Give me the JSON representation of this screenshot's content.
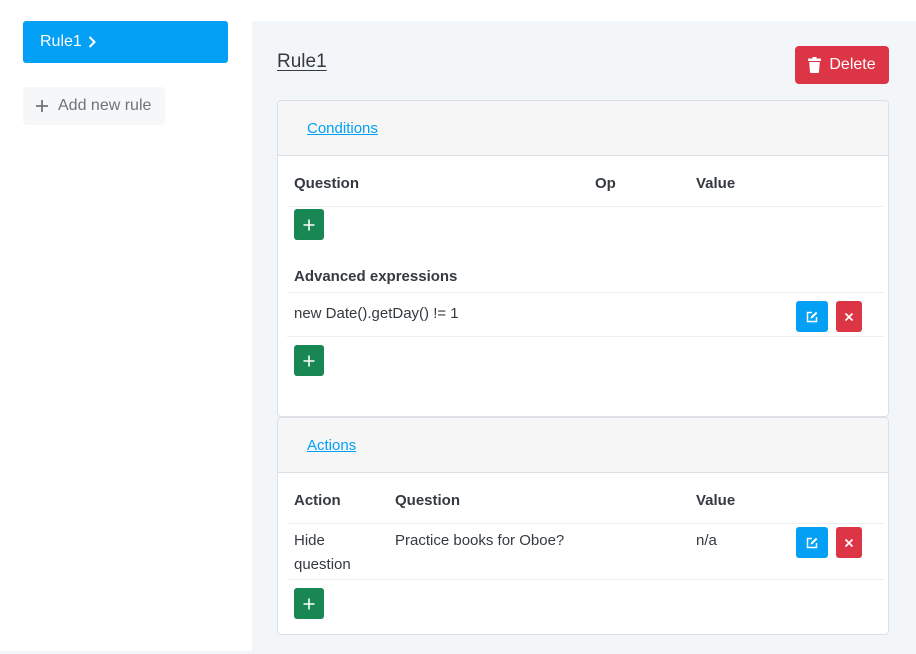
{
  "sidebar": {
    "active_rule": "Rule1",
    "add_rule_label": "Add new rule"
  },
  "main": {
    "rule_title": "Rule1",
    "delete_label": "Delete",
    "conditions": {
      "header_link": "Conditions",
      "columns": [
        "Question",
        "Op",
        "Value"
      ],
      "rows": [],
      "advanced_title": "Advanced expressions",
      "advanced_expressions": [
        "new Date().getDay() != 1"
      ]
    },
    "actions": {
      "header_link": "Actions",
      "columns": [
        "Action",
        "Question",
        "Value"
      ],
      "rows": [
        {
          "action": "Hide question",
          "question": "Practice books for Oboe?",
          "value": "n/a"
        }
      ]
    }
  },
  "colors": {
    "primary": "#03a0f6",
    "danger": "#dc3545",
    "success": "#198754",
    "panel_bg": "#f3f6f9"
  },
  "icons": {
    "chevron": "chevron-right-icon",
    "plus": "plus-icon",
    "trash": "trash-icon",
    "edit": "edit-icon",
    "close": "close-icon"
  }
}
